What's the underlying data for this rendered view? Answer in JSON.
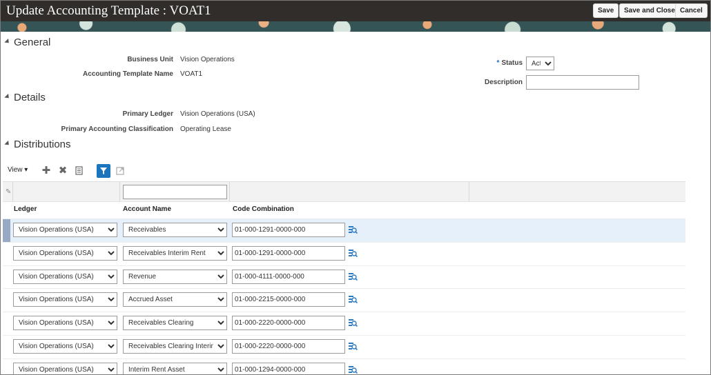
{
  "header": {
    "title": "Update Accounting Template : VOAT1",
    "save_label": "Save",
    "save_close_label": "Save and Close",
    "cancel_label": "Cancel"
  },
  "general": {
    "section_title": "General",
    "business_unit_label": "Business Unit",
    "business_unit_value": "Vision Operations",
    "template_name_label": "Accounting Template Name",
    "template_name_value": "VOAT1",
    "status_label": "Status",
    "status_value": "Active",
    "description_label": "Description",
    "description_value": ""
  },
  "details": {
    "section_title": "Details",
    "primary_ledger_label": "Primary Ledger",
    "primary_ledger_value": "Vision Operations (USA)",
    "classification_label": "Primary Accounting Classification",
    "classification_value": "Operating Lease"
  },
  "distributions": {
    "section_title": "Distributions",
    "view_label": "View",
    "columns": {
      "ledger": "Ledger",
      "account_name": "Account Name",
      "code_combination": "Code Combination"
    },
    "rows": [
      {
        "ledger": "Vision Operations (USA)",
        "account_name": "Receivables",
        "code": "01-000-1291-0000-000",
        "selected": true
      },
      {
        "ledger": "Vision Operations (USA)",
        "account_name": "Receivables Interim Rent",
        "code": "01-000-1291-0000-000",
        "selected": false
      },
      {
        "ledger": "Vision Operations (USA)",
        "account_name": "Revenue",
        "code": "01-000-4111-0000-000",
        "selected": false
      },
      {
        "ledger": "Vision Operations (USA)",
        "account_name": "Accrued Asset",
        "code": "01-000-2215-0000-000",
        "selected": false
      },
      {
        "ledger": "Vision Operations (USA)",
        "account_name": "Receivables Clearing",
        "code": "01-000-2220-0000-000",
        "selected": false
      },
      {
        "ledger": "Vision Operations (USA)",
        "account_name": "Receivables Clearing Interim Rent",
        "code": "01-000-2220-0000-000",
        "selected": false
      },
      {
        "ledger": "Vision Operations (USA)",
        "account_name": "Interim Rent Asset",
        "code": "01-000-1294-0000-000",
        "selected": false
      }
    ]
  }
}
